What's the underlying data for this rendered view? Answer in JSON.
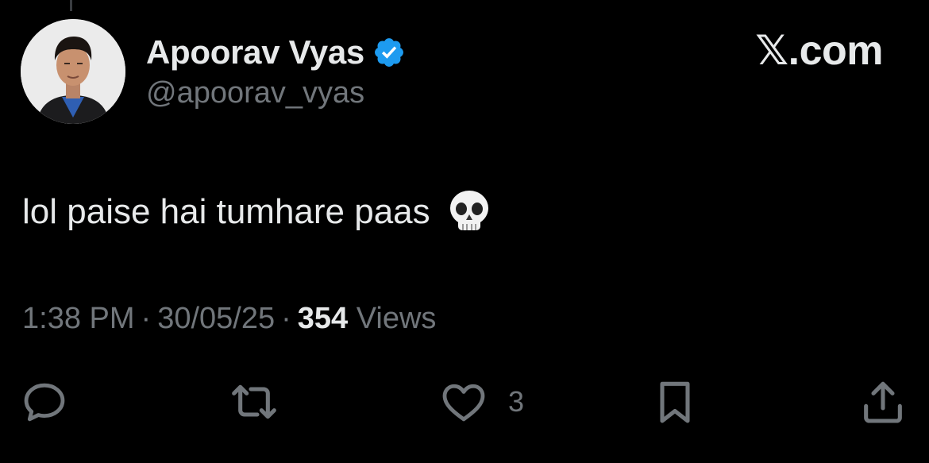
{
  "author": {
    "name": "Apoorav Vyas",
    "handle": "@apoorav_vyas",
    "verified": true,
    "verified_color": "#1d9bf0"
  },
  "brand": "𝕏.com",
  "tweet": {
    "text": "lol paise hai tumhare paas",
    "emoji": "skull-emoji"
  },
  "meta": {
    "time": "1:38 PM",
    "separator": "·",
    "date": "30/05/25",
    "views_count": "354",
    "views_label": "Views"
  },
  "actions": {
    "reply": {
      "icon": "reply-icon",
      "count": ""
    },
    "repost": {
      "icon": "repost-icon",
      "count": ""
    },
    "like": {
      "icon": "heart-icon",
      "count": "3"
    },
    "bookmark": {
      "icon": "bookmark-icon",
      "count": ""
    },
    "share": {
      "icon": "share-icon",
      "count": ""
    }
  },
  "colors": {
    "background": "#000000",
    "primary_text": "#e7e9ea",
    "secondary_text": "#71767b"
  }
}
